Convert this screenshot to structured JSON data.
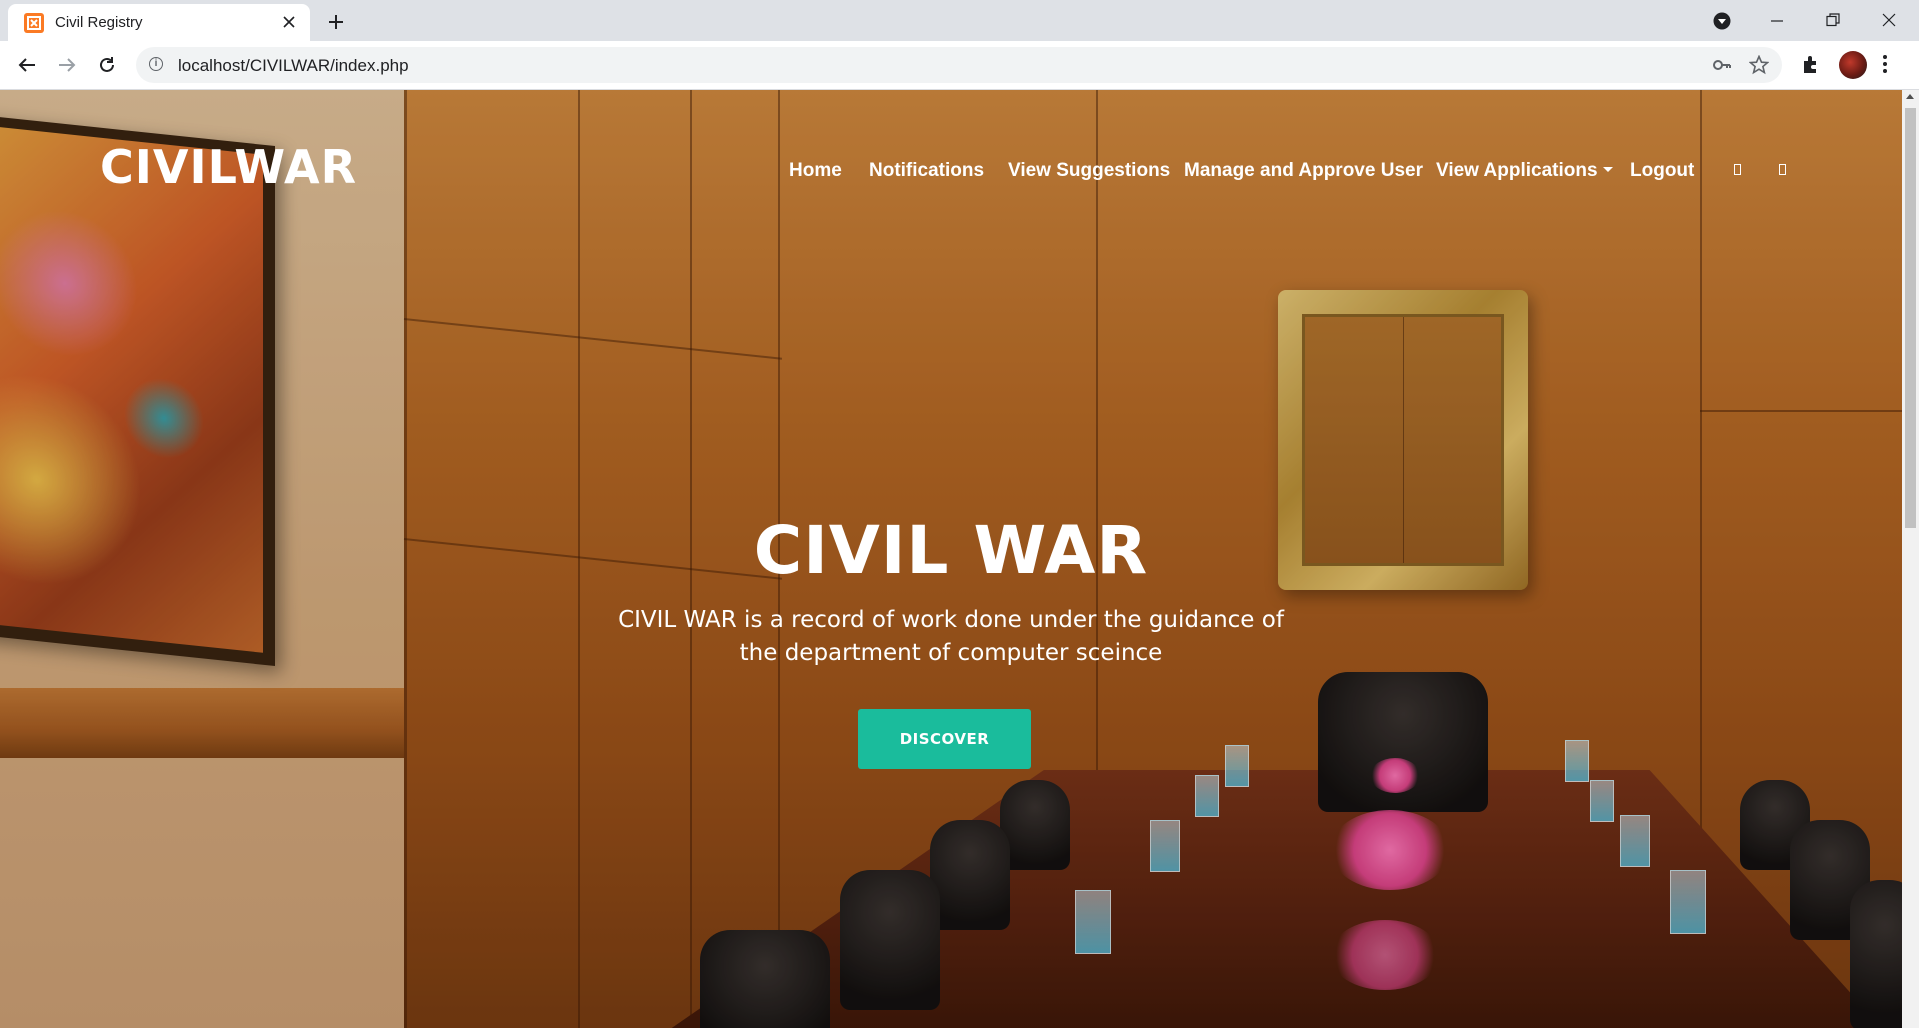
{
  "browser": {
    "tab_title": "Civil Registry",
    "url": "localhost/CIVILWAR/index.php",
    "icons": [
      "favicon-icon",
      "close-icon",
      "new-tab-icon",
      "back-icon",
      "forward-icon",
      "reload-icon",
      "info-icon",
      "key-icon",
      "star-icon",
      "extensions-icon",
      "profile-avatar",
      "menu-icon",
      "media-icon",
      "minimize-icon",
      "restore-icon",
      "window-close-icon"
    ]
  },
  "site": {
    "logo": "CIVILWAR",
    "nav": [
      {
        "label": "Home"
      },
      {
        "label": "Notifications"
      },
      {
        "label": "View Suggestions"
      },
      {
        "label": "Manage and Approve User"
      },
      {
        "label": "View Applications"
      },
      {
        "label": "Logout"
      }
    ],
    "hero": {
      "title": "CIVIL WAR",
      "subtitle": "CIVIL WAR is a record of work done under the guidance of the department of computer sceince",
      "button": "DISCOVER"
    },
    "colors": {
      "accent": "#1abc9c",
      "text": "#ffffff"
    }
  }
}
